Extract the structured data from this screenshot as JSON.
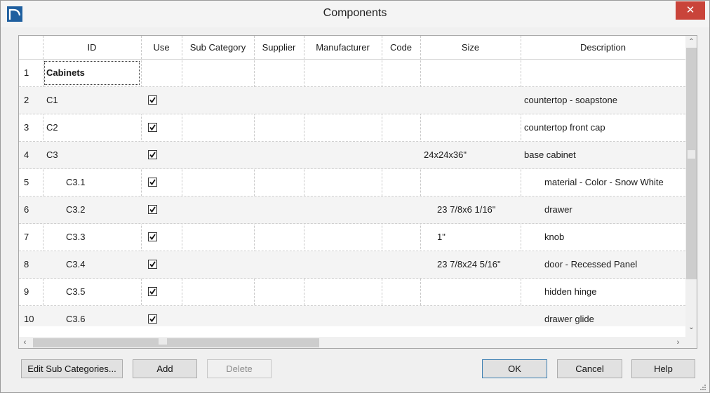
{
  "window": {
    "title": "Components",
    "close_glyph": "✕"
  },
  "table": {
    "columns": [
      "ID",
      "Use",
      "Sub Category",
      "Supplier",
      "Manufacturer",
      "Code",
      "Size",
      "Description"
    ],
    "rows": [
      {
        "num": "1",
        "id": "Cabinets",
        "use": false,
        "size": "",
        "description": ""
      },
      {
        "num": "2",
        "id": "C1",
        "use": true,
        "size": "",
        "description": "countertop - soapstone"
      },
      {
        "num": "3",
        "id": "C2",
        "use": true,
        "size": "",
        "description": "countertop front cap"
      },
      {
        "num": "4",
        "id": "C3",
        "use": true,
        "size": "24x24x36\"",
        "description": "base cabinet"
      },
      {
        "num": "5",
        "id": "C3.1",
        "use": true,
        "size": "",
        "description": "material - Color - Snow White"
      },
      {
        "num": "6",
        "id": "C3.2",
        "use": true,
        "size": "23 7/8x6 1/16\"",
        "description": "drawer"
      },
      {
        "num": "7",
        "id": "C3.3",
        "use": true,
        "size": "1\"",
        "description": "knob"
      },
      {
        "num": "8",
        "id": "C3.4",
        "use": true,
        "size": "23 7/8x24 5/16\"",
        "description": "door - Recessed Panel"
      },
      {
        "num": "9",
        "id": "C3.5",
        "use": true,
        "size": "",
        "description": "hidden hinge"
      },
      {
        "num": "10",
        "id": "C3.6",
        "use": true,
        "size": "",
        "description": "drawer glide"
      }
    ]
  },
  "scrollbars": {
    "up_glyph": "⌃",
    "down_glyph": "⌄",
    "left_glyph": "‹",
    "right_glyph": "›"
  },
  "buttons": {
    "edit_sub_categories": "Edit Sub Categories...",
    "add": "Add",
    "delete": "Delete",
    "ok": "OK",
    "cancel": "Cancel",
    "help": "Help"
  },
  "colors": {
    "close_button": "#c9443a",
    "app_icon": "#1f5f9f",
    "default_button_border": "#3c7fb1"
  }
}
